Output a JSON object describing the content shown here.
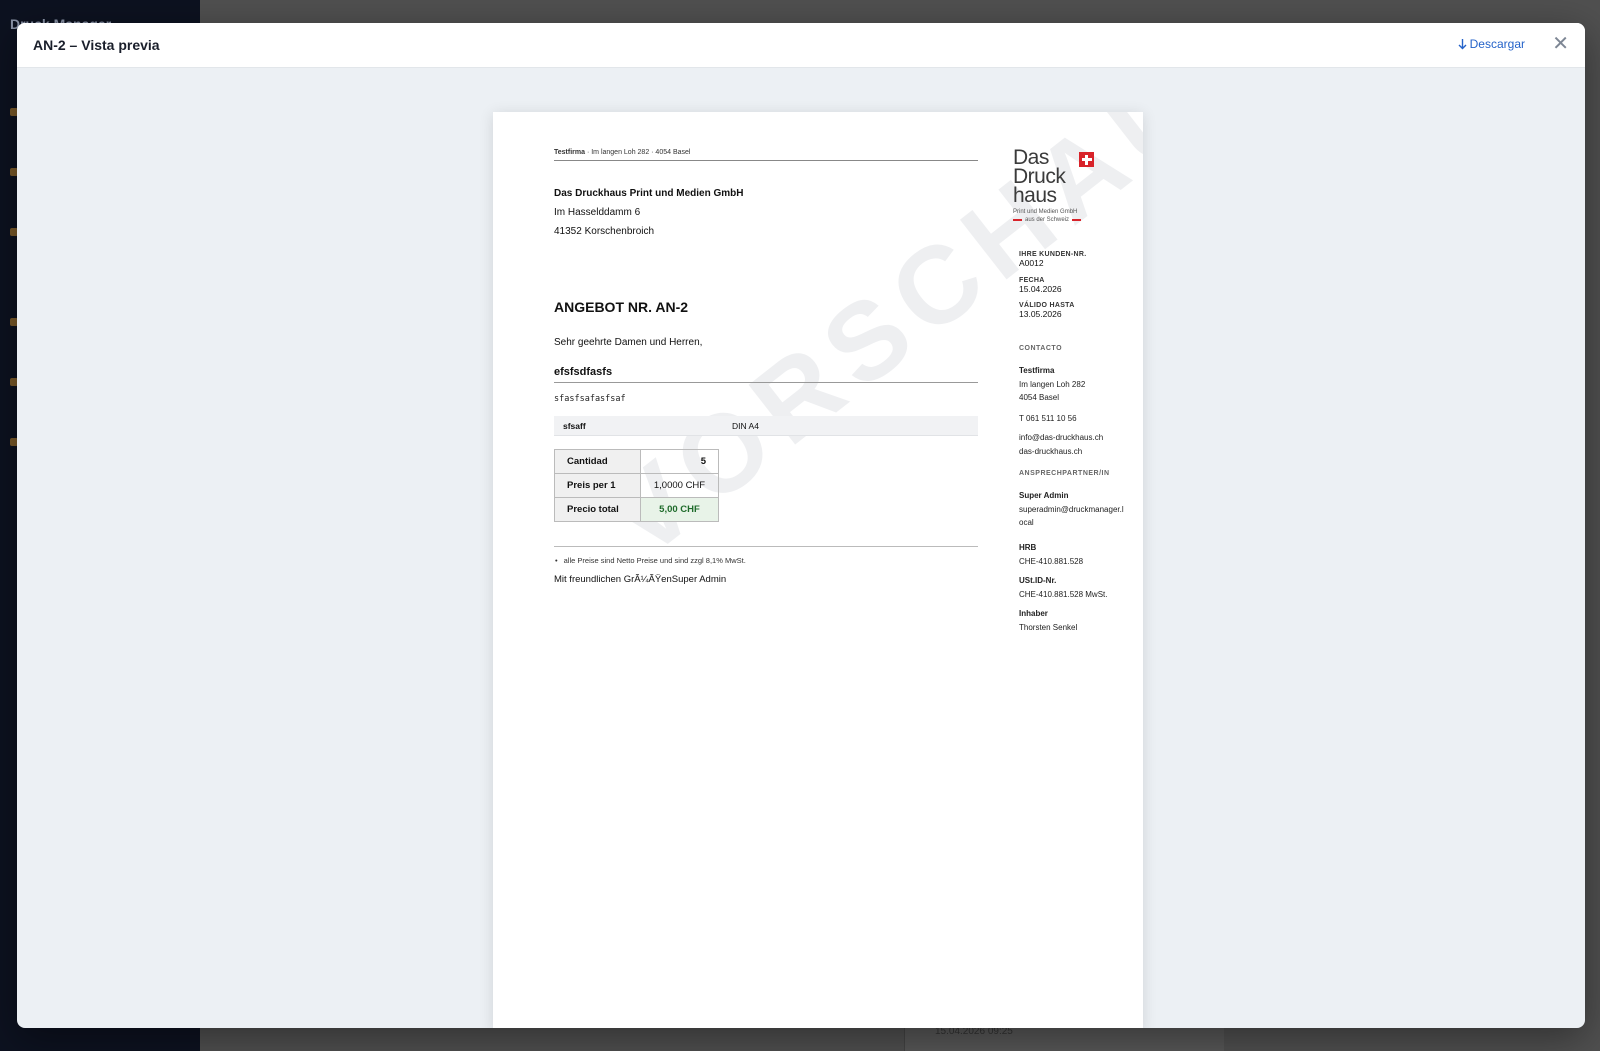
{
  "modal": {
    "title": "AN-2 – Vista previa",
    "download_label": "Descargar",
    "download_icon": "arrow-down-icon",
    "close_icon": "close-icon",
    "close_glyph": "✕"
  },
  "background": {
    "brand": "Druck Manager",
    "card_date": "15.04.2026 09:25"
  },
  "document": {
    "watermark": "VORSCHAU",
    "sender_company": "Testfirma",
    "sender_address": " · Im langen Loh 282 · 4054 Basel",
    "recipient": {
      "name": "Das Druckhaus Print und Medien GmbH",
      "street": "Im Hasselddamm 6",
      "city": "41352 Korschenbroich"
    },
    "title": "ANGEBOT NR. AN-2",
    "salutation": "Sehr geehrte Damen und Herren,",
    "product_title": "efsfsdfasfs",
    "product_description": "sfasfsafasfsaf",
    "spec": {
      "key": "sfsaff",
      "value": "DIN A4"
    },
    "price_table": [
      {
        "label": "Cantidad",
        "value": "5"
      },
      {
        "label": "Preis per 1",
        "value": "1,0000 CHF"
      },
      {
        "label": "Precio total",
        "value": "5,00 CHF"
      }
    ],
    "note": "alle Preise sind Netto Preise und sind zzgl 8,1% MwSt.",
    "closing": "Mit freundlichen GrÃ¼ÃŸenSuper Admin"
  },
  "logo": {
    "line1": "Das",
    "line2": "Druck",
    "line3": "haus",
    "sub1": "Print und Medien GmbH",
    "sub2": "aus der Schweiz"
  },
  "meta": {
    "customer_label": "IHRE KUNDEN-NR.",
    "customer_value": "A0012",
    "date_label": "FECHA",
    "date_value": "15.04.2026",
    "valid_label": "VÁLIDO HASTA",
    "valid_value": "13.05.2026"
  },
  "contact": {
    "heading": "CONTACTO",
    "company": "Testfirma",
    "street": "Im langen Loh 282",
    "city": "4054 Basel",
    "phone": "T 061 511 10 56",
    "email": "info@das-druckhaus.ch",
    "web": "das-druckhaus.ch"
  },
  "partner": {
    "heading": "ANSPRECHPARTNER/IN",
    "name": "Super Admin",
    "email_line1": "superadmin@druckmanager.l",
    "email_line2": "ocal"
  },
  "legal": {
    "hrb_label": "HRB",
    "hrb_value": "CHE-410.881.528",
    "ust_label": "USt.ID-Nr.",
    "ust_value": "CHE-410.881.528 MwSt.",
    "owner_label": "Inhaber",
    "owner_value": "Thorsten Senkel"
  }
}
